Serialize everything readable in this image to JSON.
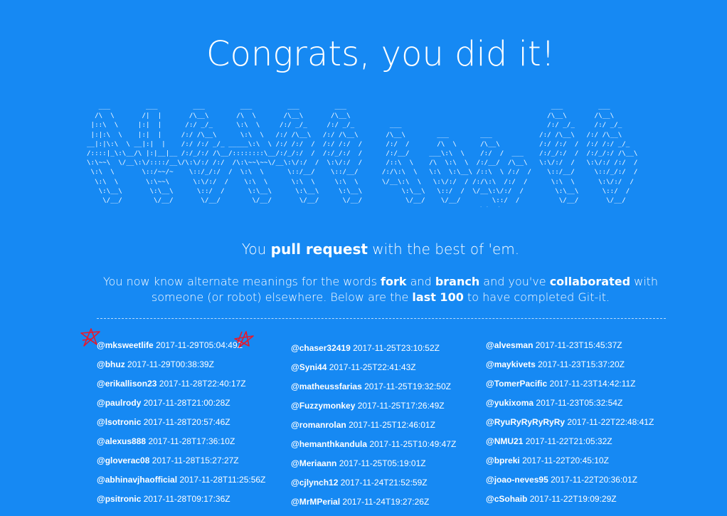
{
  "page": {
    "title": "Congrats, you did it!",
    "ascii_art": "   ___         ___         ___         ___         ___         ___                                                    ___         ___\n  /\\  \\       /|  |       /\\__\\       /\\  \\       /\\__\\       /\\__\\                                                  /\\__\\       /\\__\\\n |::\\  \\     |:|  |      /:/ _/_      \\:\\  \\     /:/ _/_     /:/ _/_         ___                                     /:/ _/_     /:/ _/_\n |:|:\\  \\    |:|  |     /:/ /\\__\\      \\:\\  \\   /:/ /\\__\\   /:/ /\\__\\       /\\__\\        ___        ___            /:/ /\\__\\   /:/ /\\__\\\n__|:|\\:\\  \\ __|:|  |    /:/ /:/ _/_ _____\\:\\  \\ /:/ /:/  /  /:/ /:/  /      /:/  /       /\\  \\      /\\__\\          /:/ /:/  /  /:/ /:/ _/_\n/::::|_\\:\\__/\\ |:|__|__ /:/_/:/ /\\__/::::::::\\__/:/_/:/  /  /:/_/:/  /      /:/__/     ___\\:\\  \\    /:/  /  ___    /:/_/:/  /  /:/_/:/ /\\__\\\n\\:\\~~\\  \\/__\\:\\/::::/__\\/\\:\\/:/ /:/  /\\:\\~~\\~~\\/__\\:\\/:/  /  \\:\\/:/  /      /::\\  \\    /\\  \\:\\  \\  /:/__/  /\\__\\   \\:\\/:/  /   \\:\\/:/ /:/  /\n \\:\\  \\       \\::/~~/~    \\::/_/:/  /  \\:\\  \\      \\::/__/    \\::/__/      /:/\\:\\  \\   \\:\\  \\:\\__\\ /::\\  \\ /:/  /    \\::/__/     \\::/_/:/  /\n  \\:\\  \\       \\:\\~~\\      \\:\\/:/  /    \\:\\  \\      \\:\\  \\     \\:\\  \\      \\/__\\:\\  \\   \\:\\/:/  / /:/\\:\\  /:/  /      \\:\\  \\      \\:\\/:/  /\n   \\:\\__\\       \\:\\__\\      \\::/  /      \\:\\__\\      \\:\\__\\     \\:\\__\\          \\:\\__\\   \\::/  /  \\/__\\:\\/:/  /        \\:\\__\\      \\::/  /\n    \\/__/        \\/__/       \\/__/        \\/__/       \\/__/      \\/__/           \\/__/    \\/__/        \\::/  /          \\/__/       \\/__/\n                                                                                                    \\/__/",
    "tagline": {
      "pre": "You ",
      "bold": "pull request",
      "post": " with the best of 'em."
    },
    "desc": {
      "t1": "You now know alternate meanings for the words ",
      "b1": "fork",
      "t2": " and ",
      "b2": "branch",
      "t3": " and you've ",
      "b3": "collaborated",
      "t4": " with someone (or robot) elsewhere. Below are the ",
      "b4": "last 100",
      "t5": " to have completed Git-it."
    },
    "columns": [
      [
        {
          "user": "@mksweetlife",
          "time": "2017-11-29T05:04:49Z"
        },
        {
          "user": "@bhuz",
          "time": "2017-11-29T00:38:39Z"
        },
        {
          "user": "@erikallison23",
          "time": "2017-11-28T22:40:17Z"
        },
        {
          "user": "@paulrody",
          "time": "2017-11-28T21:00:28Z"
        },
        {
          "user": "@lsotronic",
          "time": "2017-11-28T20:57:46Z"
        },
        {
          "user": "@alexus888",
          "time": "2017-11-28T17:36:10Z"
        },
        {
          "user": "@gloverac08",
          "time": "2017-11-28T15:27:27Z"
        },
        {
          "user": "@abhinavjhaofficial",
          "time": "2017-11-28T11:25:56Z"
        },
        {
          "user": "@psitronic",
          "time": "2017-11-28T09:17:36Z"
        }
      ],
      [
        {
          "user": "@chaser32419",
          "time": "2017-11-25T23:10:52Z"
        },
        {
          "user": "@Syni44",
          "time": "2017-11-25T22:41:43Z"
        },
        {
          "user": "@matheussfarias",
          "time": "2017-11-25T19:32:50Z"
        },
        {
          "user": "@Fuzzymonkey",
          "time": "2017-11-25T17:26:49Z"
        },
        {
          "user": "@romanrolan",
          "time": "2017-11-25T12:46:01Z"
        },
        {
          "user": "@hemanthkandula",
          "time": "2017-11-25T10:49:47Z"
        },
        {
          "user": "@Meriaann",
          "time": "2017-11-25T05:19:01Z"
        },
        {
          "user": "@cjlynch12",
          "time": "2017-11-24T21:52:59Z"
        },
        {
          "user": "@MrMPerial",
          "time": "2017-11-24T19:27:26Z"
        }
      ],
      [
        {
          "user": "@alvesman",
          "time": "2017-11-23T15:45:37Z"
        },
        {
          "user": "@maykivets",
          "time": "2017-11-23T15:37:20Z"
        },
        {
          "user": "@TomerPacific",
          "time": "2017-11-23T14:42:11Z"
        },
        {
          "user": "@yukixoma",
          "time": "2017-11-23T05:32:54Z"
        },
        {
          "user": "@RyuRyRyRyRyRy",
          "time": "2017-11-22T22:48:41Z"
        },
        {
          "user": "@NMU21",
          "time": "2017-11-22T21:05:32Z"
        },
        {
          "user": "@bpreki",
          "time": "2017-11-22T20:45:10Z"
        },
        {
          "user": "@joao-neves95",
          "time": "2017-11-22T20:36:01Z"
        },
        {
          "user": "@cSohaib",
          "time": "2017-11-22T19:09:29Z"
        }
      ]
    ],
    "colors": {
      "background": "#1689f3",
      "text": "#ffffff",
      "doodle": "#e8182b"
    }
  }
}
